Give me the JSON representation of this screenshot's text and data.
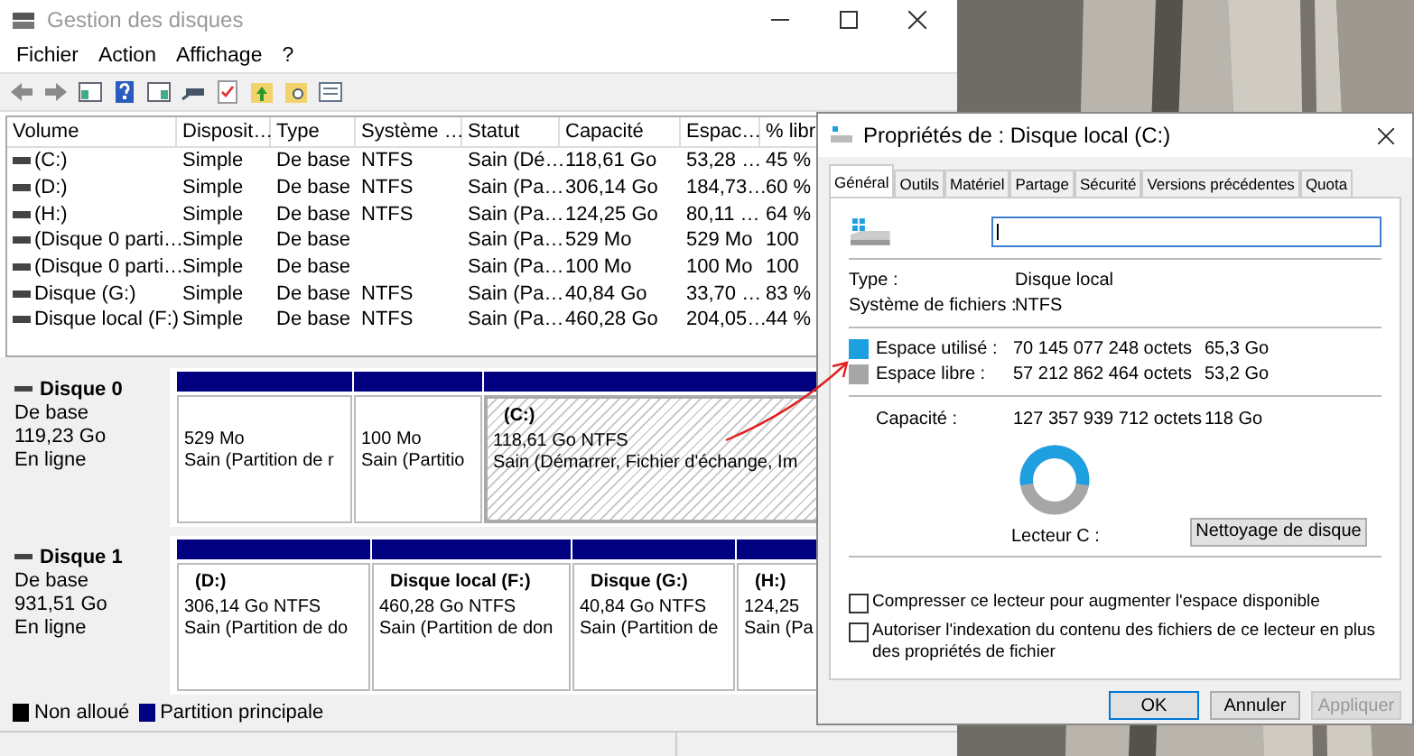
{
  "main_window": {
    "title": "Gestion des disques",
    "menu": [
      "Fichier",
      "Action",
      "Affichage",
      "?"
    ],
    "table": {
      "columns": [
        "Volume",
        "Disposit…",
        "Type",
        "Système …",
        "Statut",
        "Capacité",
        "Espac…",
        "% libr"
      ],
      "rows": [
        {
          "volume": "(C:)",
          "layout": "Simple",
          "type": "De base",
          "fs": "NTFS",
          "status": "Sain (Dé…",
          "capacity": "118,61 Go",
          "free": "53,28 …",
          "pct": "45 %"
        },
        {
          "volume": "(D:)",
          "layout": "Simple",
          "type": "De base",
          "fs": "NTFS",
          "status": "Sain (Pa…",
          "capacity": "306,14 Go",
          "free": "184,73…",
          "pct": "60 %"
        },
        {
          "volume": "(H:)",
          "layout": "Simple",
          "type": "De base",
          "fs": "NTFS",
          "status": "Sain (Pa…",
          "capacity": "124,25 Go",
          "free": "80,11 …",
          "pct": "64 %"
        },
        {
          "volume": "(Disque 0 parti…",
          "layout": "Simple",
          "type": "De base",
          "status": "Sain (Pa…",
          "capacity": "529 Mo",
          "free": "529 Mo",
          "pct": "100"
        },
        {
          "volume": "(Disque 0 parti…",
          "layout": "Simple",
          "type": "De base",
          "status": "Sain (Pa…",
          "capacity": "100 Mo",
          "free": "100 Mo",
          "pct": "100"
        },
        {
          "volume": "Disque (G:)",
          "layout": "Simple",
          "type": "De base",
          "fs": "NTFS",
          "status": "Sain (Pa…",
          "capacity": "40,84 Go",
          "free": "33,70 …",
          "pct": "83 %"
        },
        {
          "volume": "Disque local (F:)",
          "layout": "Simple",
          "type": "De base",
          "fs": "NTFS",
          "status": "Sain (Pa…",
          "capacity": "460,28 Go",
          "free": "204,05…",
          "pct": "44 %"
        }
      ]
    },
    "disks": [
      {
        "name": "Disque 0",
        "kind": "De base",
        "size": "119,23 Go",
        "state": "En ligne",
        "partitions": [
          {
            "size": "529 Mo",
            "status": "Sain (Partition de r",
            "selected": false
          },
          {
            "size": "100 Mo",
            "status": "Sain (Partitio",
            "selected": false
          },
          {
            "name": "(C:)",
            "size": "118,61 Go NTFS",
            "status": "Sain (Démarrer, Fichier d'échange, Im",
            "selected": true
          }
        ]
      },
      {
        "name": "Disque 1",
        "kind": "De base",
        "size": "931,51 Go",
        "state": "En ligne",
        "partitions": [
          {
            "name": "(D:)",
            "size": "306,14 Go NTFS",
            "status": "Sain (Partition de do",
            "selected": false
          },
          {
            "name": "Disque local  (F:)",
            "size": "460,28 Go NTFS",
            "status": "Sain (Partition de don",
            "selected": false
          },
          {
            "name": "Disque  (G:)",
            "size": "40,84 Go NTFS",
            "status": "Sain (Partition de",
            "selected": false
          },
          {
            "name": "(H:)",
            "size": "124,25",
            "status": "Sain (Pa",
            "selected": false
          }
        ]
      }
    ],
    "legend": [
      {
        "label": "Non alloué",
        "color": "#000000"
      },
      {
        "label": "Partition principale",
        "color": "#000080"
      }
    ]
  },
  "dialog": {
    "title": "Propriétés de : Disque local (C:)",
    "tabs": [
      {
        "label": "Général",
        "selected": true
      },
      {
        "label": "Outils",
        "selected": false
      },
      {
        "label": "Matériel",
        "selected": false
      },
      {
        "label": "Partage",
        "selected": false
      },
      {
        "label": "Sécurité",
        "selected": false
      },
      {
        "label": "Versions précédentes",
        "selected": false
      },
      {
        "label": "Quota",
        "selected": false
      }
    ],
    "info": [
      {
        "label": "Type :",
        "value": "Disque local"
      },
      {
        "label": "Système de fichiers :",
        "value": "NTFS"
      }
    ],
    "space": [
      {
        "label": "Espace utilisé :",
        "bytes": "70 145 077 248 octets",
        "size": "65,3 Go",
        "color": "#1e9fe0"
      },
      {
        "label": "Espace libre :",
        "bytes": "57 212 862 464 octets",
        "size": "53,2 Go",
        "color": "#a6a6a6"
      }
    ],
    "capacity": {
      "label": "Capacité :",
      "bytes": "127 357 939 712 octets",
      "size": "118 Go"
    },
    "drive_label": "Lecteur C :",
    "cleanup_button": "Nettoyage de disque",
    "options": [
      {
        "label": "Compresser ce lecteur pour augmenter l'espace disponible",
        "checked": false
      },
      {
        "label": "Autoriser l'indexation du contenu des fichiers de ce lecteur en plus des propriétés de fichier",
        "checked": false
      }
    ],
    "buttons": [
      {
        "label": "OK",
        "disabled": false
      },
      {
        "label": "Annuler",
        "disabled": false
      },
      {
        "label": "Appliquer",
        "disabled": true
      }
    ]
  }
}
